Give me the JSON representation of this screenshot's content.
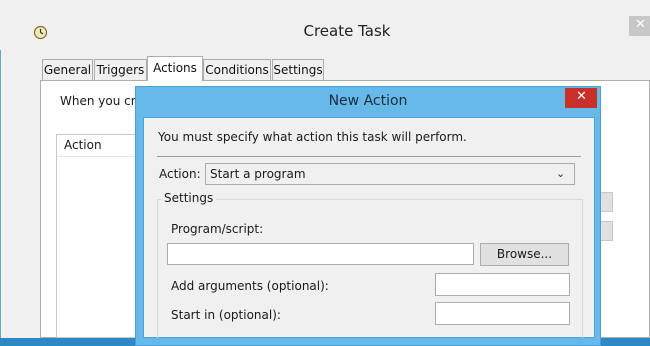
{
  "create_task": {
    "title": "Create Task",
    "tabs": [
      {
        "label": "General"
      },
      {
        "label": "Triggers"
      },
      {
        "label": "Actions",
        "active": true
      },
      {
        "label": "Conditions"
      },
      {
        "label": "Settings"
      }
    ],
    "description_visible": "When you crea",
    "action_column_header": "Action",
    "icons": {
      "app": "clock-icon",
      "close": "close-icon"
    }
  },
  "new_action": {
    "title": "New Action",
    "instruction": "You must specify what action this task will perform.",
    "action_label": "Action:",
    "action_selected": "Start a program",
    "settings_label": "Settings",
    "program_label": "Program/script:",
    "program_value": "",
    "browse_label": "Browse...",
    "arguments_label": "Add arguments (optional):",
    "arguments_value": "",
    "start_in_label": "Start in (optional):",
    "start_in_value": "",
    "icons": {
      "close": "close-icon",
      "dropdown": "chevron-down-icon"
    }
  },
  "colors": {
    "desktop": "#2f88c6",
    "dialog_frame": "#66b9e8",
    "close_red": "#c9302a",
    "window_bg": "#f0f0f0"
  }
}
